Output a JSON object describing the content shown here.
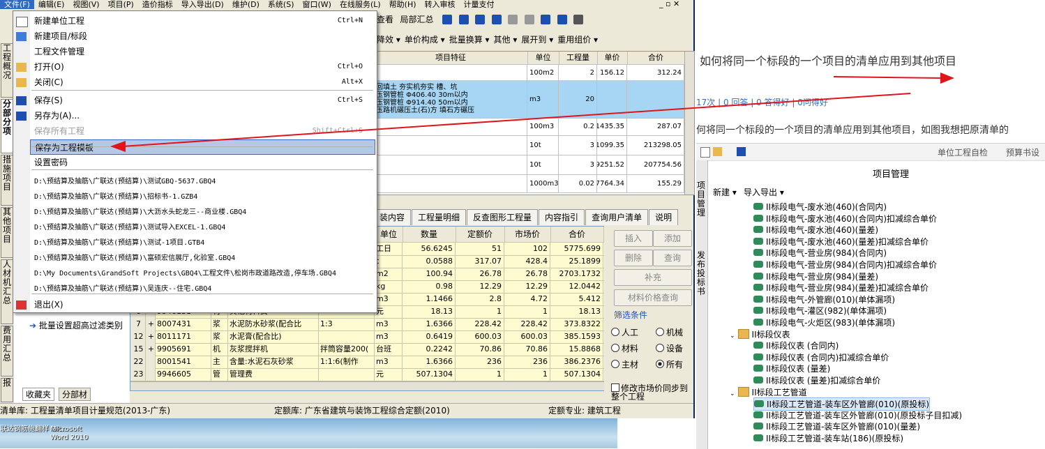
{
  "menubar": {
    "items": [
      "文件(F)",
      "编辑(E)",
      "视图(V)",
      "项目(P)",
      "造价指标",
      "导入导出(D)",
      "维护(D)",
      "系统(S)",
      "窗口(W)",
      "在线服务(L)",
      "帮助(H)",
      "转入审核",
      "计量支付"
    ]
  },
  "toolbar1": {
    "items": [
      "查看",
      "局部汇总"
    ]
  },
  "toolbar2": {
    "items": [
      "降效 ▾",
      "单价构成 ▾",
      "批量换算 ▾",
      "其他 ▾",
      "展开到 ▾",
      "重用组价 ▾"
    ]
  },
  "vtabs": [
    "工程概况",
    "分部分项",
    "措施项目",
    "其他项目",
    "人材机汇总",
    "费用汇总",
    "报"
  ],
  "file_menu": {
    "items": [
      {
        "label": "新建单位工程",
        "shortcut": "Ctrl+N"
      },
      {
        "label": "新建项目/标段",
        "shortcut": ""
      },
      {
        "label": "工程文件管理",
        "shortcut": ""
      },
      {
        "label": "打开(O)",
        "shortcut": "Ctrl+O"
      },
      {
        "label": "关闭(C)",
        "shortcut": "Alt+X"
      },
      {
        "label": "保存(S)",
        "shortcut": "Ctrl+S"
      },
      {
        "label": "另存为(A)...",
        "shortcut": ""
      },
      {
        "label": "保存所有工程",
        "shortcut": "Shift+Ctrl+S"
      },
      {
        "label": "保存为工程模板",
        "shortcut": ""
      },
      {
        "label": "设置密码",
        "shortcut": ""
      },
      {
        "label": "退出(X)",
        "shortcut": ""
      }
    ],
    "recent": [
      "D:\\预结算及抽筋\\广联达(预结算)\\测试GBQ-5637.GBQ4",
      "D:\\预结算及抽筋\\广联达(预结算)\\招标书-1.GZB4",
      "D:\\预结算及抽筋\\广联达(预结算)\\大沥水头蛇龙三--商业楼.GBQ4",
      "D:\\预结算及抽筋\\广联达(预结算)\\测试导入EXCEL-1.GBQ4",
      "D:\\预结算及抽筋\\广联达(预结算)\\测试-1项目.GTB4",
      "D:\\预结算及抽筋\\广联达(预结算)\\富硕宏信展厅,化验室.GBQ4",
      "D:\\My Documents\\GrandSoft Projects\\GBQ4\\工程文件\\松岗市政道路改造,停车场.GBQ4",
      "D:\\预结算及抽筋\\广联达(预结算)\\吴连庆--住宅.GBQ4"
    ]
  },
  "grid1": {
    "headers": [
      "项目特征",
      "单位",
      "工程量",
      "单价",
      "合价"
    ],
    "rows": [
      {
        "feature": "",
        "unit": "100m2",
        "qty": "2",
        "price": "156.12",
        "total": "312.24"
      },
      {
        "feature": "回填土 夯实机夯实 槽、坑\n压钢管桩 Φ406.40 30m以内\n压钢管桩 Φ914.40 50m以内\n压路机碾压土(石)方 填石方碾压",
        "unit": "m3",
        "qty": "20",
        "price": "",
        "total": ""
      },
      {
        "feature": "",
        "unit": "100m3",
        "qty": "0.2",
        "price": "1435.35",
        "total": "287.07"
      },
      {
        "feature": "",
        "unit": "10t",
        "qty": "3",
        "price": "71099.35",
        "total": "213298.05"
      },
      {
        "feature": "",
        "unit": "10t",
        "qty": "3",
        "price": "69251.52",
        "total": "207754.56"
      },
      {
        "feature": "",
        "unit": "1000m3",
        "qty": "0.02",
        "price": "7764.34",
        "total": "155.29"
      }
    ]
  },
  "midtabs": [
    "装内容",
    "工程量明细",
    "反查图形工程量",
    "内容指引",
    "查询用户清单",
    "说明"
  ],
  "grid2": {
    "headers": [
      "单位",
      "数量",
      "定额价",
      "市场价",
      "合价"
    ],
    "rows": [
      {
        "no": "",
        "exp": "",
        "code": "",
        "type": "",
        "name": "",
        "spec": "",
        "unit": "工日",
        "qty": "56.6245",
        "quota": "51",
        "market": "102",
        "total": "5775.699"
      },
      {
        "no": "",
        "exp": "",
        "code": "",
        "type": "",
        "name": "",
        "spec": "",
        "unit": "t",
        "qty": "0.0588",
        "quota": "317.07",
        "market": "428.4",
        "total": "25.1899"
      },
      {
        "no": "",
        "exp": "",
        "code": "",
        "type": "",
        "name": "",
        "spec": "",
        "unit": "m2",
        "qty": "100.94",
        "quota": "26.78",
        "market": "26.78",
        "total": "2703.1732"
      },
      {
        "no": "",
        "exp": "",
        "code": "",
        "type": "",
        "name": "",
        "spec": "",
        "unit": "kg",
        "qty": "0.98",
        "quota": "12.29",
        "market": "12.29",
        "total": "12.0442"
      },
      {
        "no": "",
        "exp": "",
        "code": "",
        "type": "",
        "name": "",
        "spec": "",
        "unit": "m3",
        "qty": "1.1466",
        "quota": "2.8",
        "market": "4.72",
        "total": "5.412"
      },
      {
        "no": "6",
        "exp": "",
        "code": "9946131",
        "type": "材",
        "name": "其他材料费",
        "spec": "",
        "unit": "元",
        "qty": "18.13",
        "quota": "1",
        "market": "1",
        "total": "18.13"
      },
      {
        "no": "7",
        "exp": "+",
        "code": "8007431",
        "type": "浆",
        "name": "水泥防水砂浆(配合比",
        "spec": "1:3",
        "unit": "m3",
        "qty": "1.6366",
        "quota": "228.42",
        "market": "228.42",
        "total": "373.8322"
      },
      {
        "no": "12",
        "exp": "+",
        "code": "8011171",
        "type": "浆",
        "name": "水泥膏(配合比)",
        "spec": "",
        "unit": "m3",
        "qty": "0.6419",
        "quota": "600.03",
        "market": "600.03",
        "total": "385.1593"
      },
      {
        "no": "15",
        "exp": "+",
        "code": "9905691",
        "type": "机",
        "name": "灰浆搅拌机",
        "spec": "拌筒容量200(",
        "unit": "台班",
        "qty": "0.2242",
        "quota": "70.86",
        "market": "70.86",
        "total": "15.8868"
      },
      {
        "no": "22",
        "exp": "",
        "code": "8001541",
        "type": "主",
        "name": "含量:水泥石灰砂浆",
        "spec": "1:1:6(制作",
        "unit": "m3",
        "qty": "1.6366",
        "quota": "236",
        "market": "236",
        "total": "386.2376"
      },
      {
        "no": "23",
        "exp": "",
        "code": "9946605",
        "type": "管",
        "name": "管理费",
        "spec": "",
        "unit": "元",
        "qty": "507.1304",
        "quota": "1",
        "market": "1",
        "total": "507.1304"
      }
    ]
  },
  "rpanel": {
    "buttons": [
      "插入",
      "添加",
      "删除",
      "查询",
      "补充",
      "材料价格查询"
    ],
    "filter_title": "筛选条件",
    "radios": [
      "人工",
      "机械",
      "材料",
      "设备",
      "主材",
      "所有"
    ],
    "checkbox": "修改市场价同步到整个工程"
  },
  "leftlower": {
    "batch": "批量设置超高过滤类别",
    "tabs": [
      "收藏夹",
      "分部材"
    ]
  },
  "status": {
    "list": "清单库: 工程量清单项目计量规范(2013-广东)",
    "quota": "定额库: 广东省建筑与装饰工程综合定额(2010)",
    "major": "定额专业: 建筑工程"
  },
  "desktop": {
    "icons": [
      "联达钢筋施翻样 GF...",
      "Microsoft Word 2010"
    ]
  },
  "qa": {
    "title": "如何将同一个标段的一个项目的清单应用到其他项目",
    "meta": "17次 | 0 回答 | 0 答得好 | 0问得好",
    "body": "何将同一个标段的一个项目的清单应用到其他项目，如图我想把原清单的"
  },
  "pm": {
    "title": "项目管理",
    "toolbar": [
      "单位工程自检",
      "预算书设"
    ],
    "actions": [
      "新建 ▾",
      "导入导出 ▾"
    ],
    "side_tabs": [
      "项目管理",
      "发布投标书"
    ],
    "tree": [
      {
        "label": "II标段电气-废水池(460)(合同内)",
        "level": 2
      },
      {
        "label": "II标段电气-废水池(460)(合同内)扣减综合单价",
        "level": 2
      },
      {
        "label": "II标段电气-废水池(460)(量差)",
        "level": 2
      },
      {
        "label": "II标段电气-废水池(460)(量差)扣减综合单价",
        "level": 2
      },
      {
        "label": "II标段电气-营业房(984)(合同内)",
        "level": 2
      },
      {
        "label": "II标段电气-营业房(984)(合同内)扣减综合单价",
        "level": 2
      },
      {
        "label": "II标段电气-营业房(984)(量差)",
        "level": 2
      },
      {
        "label": "II标段电气-营业房(984)(量差)扣减综合单价",
        "level": 2
      },
      {
        "label": "II标段电气-外管廊(010)(单体漏项)",
        "level": 2
      },
      {
        "label": "II标段电气-灌区(982)(单体漏项)",
        "level": 2
      },
      {
        "label": "II标段电气-火炬区(983)(单体漏项)",
        "level": 2
      },
      {
        "label": "II标段仪表",
        "level": 1
      },
      {
        "label": "II标段仪表 (合同内)",
        "level": 2
      },
      {
        "label": "II标段仪表 (合同内)扣减综合单价",
        "level": 2
      },
      {
        "label": "II标段仪表 (量差)",
        "level": 2
      },
      {
        "label": "II标段仪表 (量差)扣减综合单价",
        "level": 2
      },
      {
        "label": "II标段工艺管道",
        "level": 1
      },
      {
        "label": "II标段工艺管道-装车区外管廊(010)(原投标)",
        "level": 2
      },
      {
        "label": "II标段工艺管道-装车区外管廊(010)(原投标子目扣减)",
        "level": 2
      },
      {
        "label": "II标段工艺管道-装车区外管廊(010)(量差)",
        "level": 2
      },
      {
        "label": "II标段工艺管道-装车站(186)(原投标)",
        "level": 2
      }
    ]
  },
  "colors": {
    "highlight": "#b6c8e8",
    "annotation_arrow": "#e0141a",
    "grid_selected": "#a6d6f4",
    "lower_grid_bg": "#fffbd0"
  }
}
